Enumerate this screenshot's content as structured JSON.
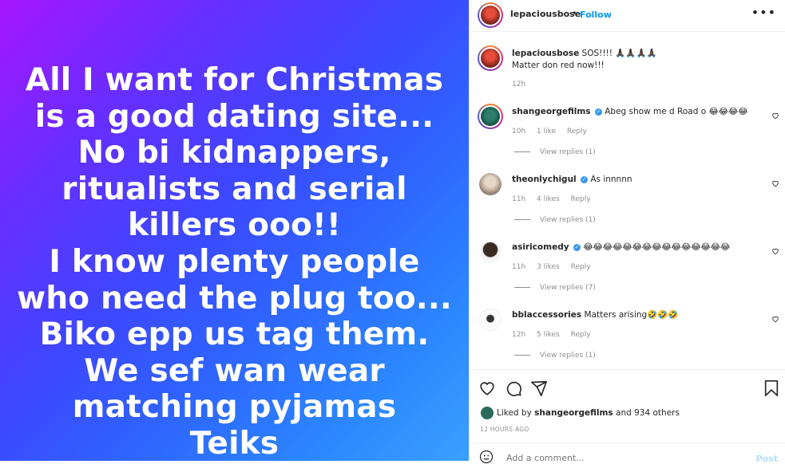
{
  "media": {
    "lines": [
      "All I want for Christmas",
      "is a good dating site...",
      "No bi kidnappers,",
      "ritualists and serial",
      "killers ooo!!",
      "I know plenty people",
      "who need the plug too...",
      "Biko epp us tag them.",
      "We sef wan wear",
      "matching pyjamas",
      "Teiks"
    ]
  },
  "header": {
    "username": "lepaciousbose",
    "separator": "•",
    "follow_label": "Follow",
    "more_label": "•••"
  },
  "caption": {
    "username": "lepaciousbose",
    "line1": "SOS!!!! 🙏🏿🙏🏿🙏🏿🙏🏿",
    "line2": "Matter don red now!!!",
    "time": "12h"
  },
  "comments": [
    {
      "username": "shangeorgefilms",
      "verified": true,
      "text": "Abeg show me d Road o 😂😂😂😂",
      "time": "10h",
      "likes": "1 like",
      "reply": "Reply",
      "view_replies": "View replies (1)"
    },
    {
      "username": "theonlychigul",
      "verified": true,
      "text": "As innnnn",
      "time": "11h",
      "likes": "4 likes",
      "reply": "Reply",
      "view_replies": "View replies (1)"
    },
    {
      "username": "asiricomedy",
      "verified": true,
      "text": "😂😂😂😂😂😂😂😂😂😂😂😂😂😂😂",
      "time": "11h",
      "likes": "3 likes",
      "reply": "Reply",
      "view_replies": "View replies (7)"
    },
    {
      "username": "bblaccessories",
      "verified": false,
      "text": "Matters arising🤣🤣🤣",
      "time": "12h",
      "likes": "5 likes",
      "reply": "Reply",
      "view_replies": "View replies (1)"
    }
  ],
  "actions": {
    "icons": [
      "heart-icon",
      "comment-icon",
      "share-icon",
      "bookmark-icon"
    ],
    "liked_by_prefix": "Liked by ",
    "liked_by_user": "shangeorgefilms",
    "liked_by_suffix": " and 934 others",
    "timestamp": "12 HOURS AGO"
  },
  "add_comment": {
    "placeholder": "Add a comment...",
    "post_label": "Post"
  },
  "colors": {
    "link_blue": "#0095f6",
    "verified_blue": "#3897f0",
    "muted": "#8e8e8e"
  }
}
